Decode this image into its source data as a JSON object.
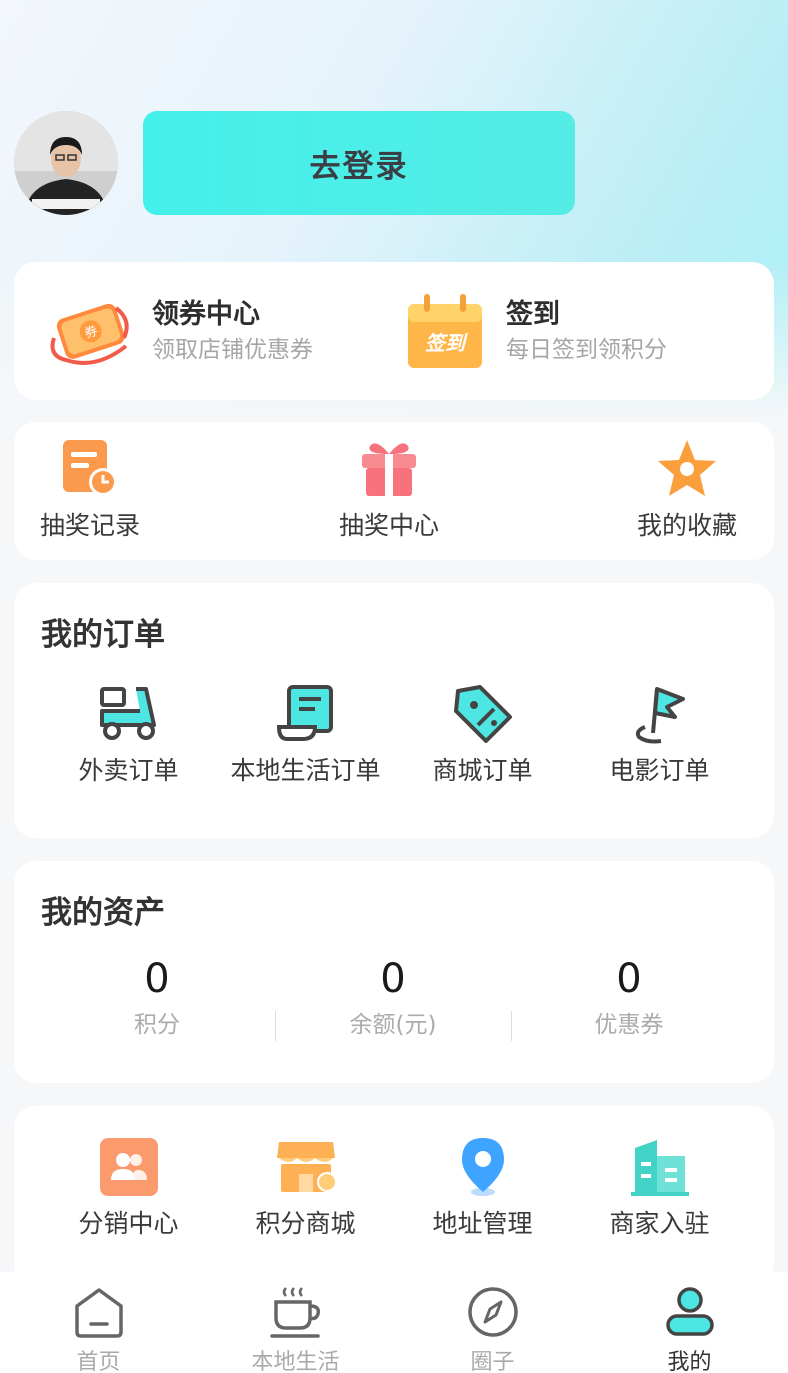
{
  "header": {
    "login_label": "去登录"
  },
  "promos": [
    {
      "title": "领券中心",
      "subtitle": "领取店铺优惠券",
      "icon": "coupon-icon"
    },
    {
      "title": "签到",
      "subtitle": "每日签到领积分",
      "icon": "calendar-checkin-icon",
      "badge": "签到"
    }
  ],
  "quick": [
    {
      "label": "抽奖记录",
      "icon": "lottery-record-icon"
    },
    {
      "label": "抽奖中心",
      "icon": "gift-icon"
    },
    {
      "label": "我的收藏",
      "icon": "star-icon"
    }
  ],
  "orders": {
    "title": "我的订单",
    "items": [
      {
        "label": "外卖订单",
        "icon": "delivery-scooter-icon"
      },
      {
        "label": "本地生活订单",
        "icon": "receipt-scroll-icon"
      },
      {
        "label": "商城订单",
        "icon": "discount-tag-icon"
      },
      {
        "label": "电影订单",
        "icon": "flag-icon"
      }
    ]
  },
  "assets": {
    "title": "我的资产",
    "items": [
      {
        "value": "0",
        "label": "积分"
      },
      {
        "value": "0",
        "label": "余额(元)"
      },
      {
        "value": "0",
        "label": "优惠券"
      }
    ]
  },
  "services": [
    {
      "label": "分销中心",
      "icon": "team-icon"
    },
    {
      "label": "积分商城",
      "icon": "shop-icon"
    },
    {
      "label": "地址管理",
      "icon": "location-pin-icon"
    },
    {
      "label": "商家入驻",
      "icon": "building-icon"
    }
  ],
  "tabbar": [
    {
      "label": "首页",
      "icon": "home-icon",
      "active": false
    },
    {
      "label": "本地生活",
      "icon": "coffee-icon",
      "active": false
    },
    {
      "label": "圈子",
      "icon": "compass-icon",
      "active": false
    },
    {
      "label": "我的",
      "icon": "user-icon",
      "active": true
    }
  ],
  "colors": {
    "accent": "#44f0ea",
    "orange": "#fb9a4c",
    "text_primary": "#333333",
    "text_secondary": "#a6a6a6"
  }
}
